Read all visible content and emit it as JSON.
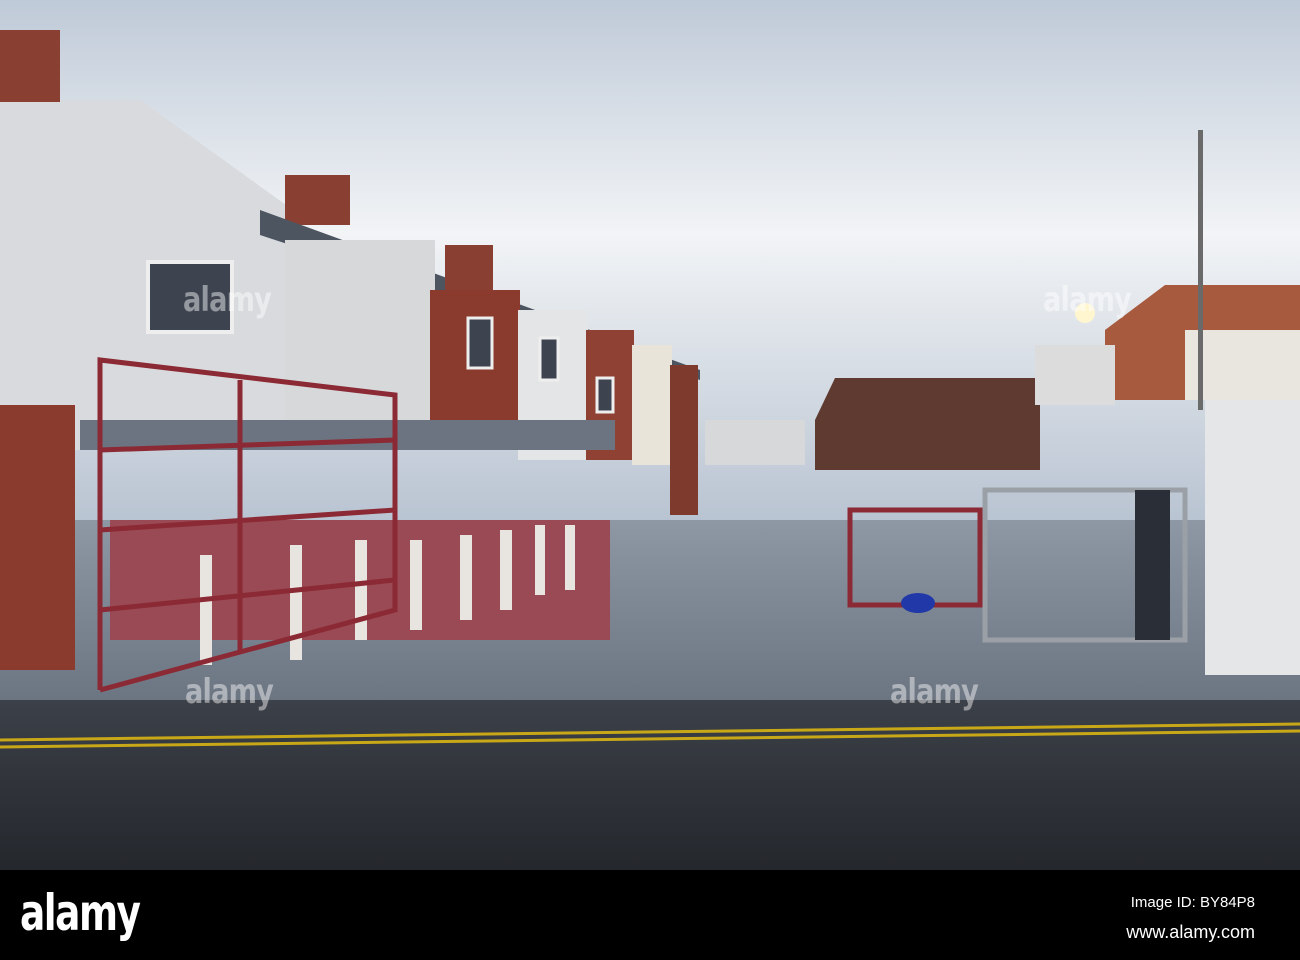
{
  "watermark": "alamy",
  "footer": {
    "logo": "alamy",
    "image_id": "Image ID: BY84P8",
    "website": "www.alamy.com"
  },
  "colors": {
    "sky": "#c9d4e0",
    "brick": "#8a3b2e",
    "rail": "#8b2a34",
    "road": "#2d3034",
    "road_line": "#c9a818"
  }
}
